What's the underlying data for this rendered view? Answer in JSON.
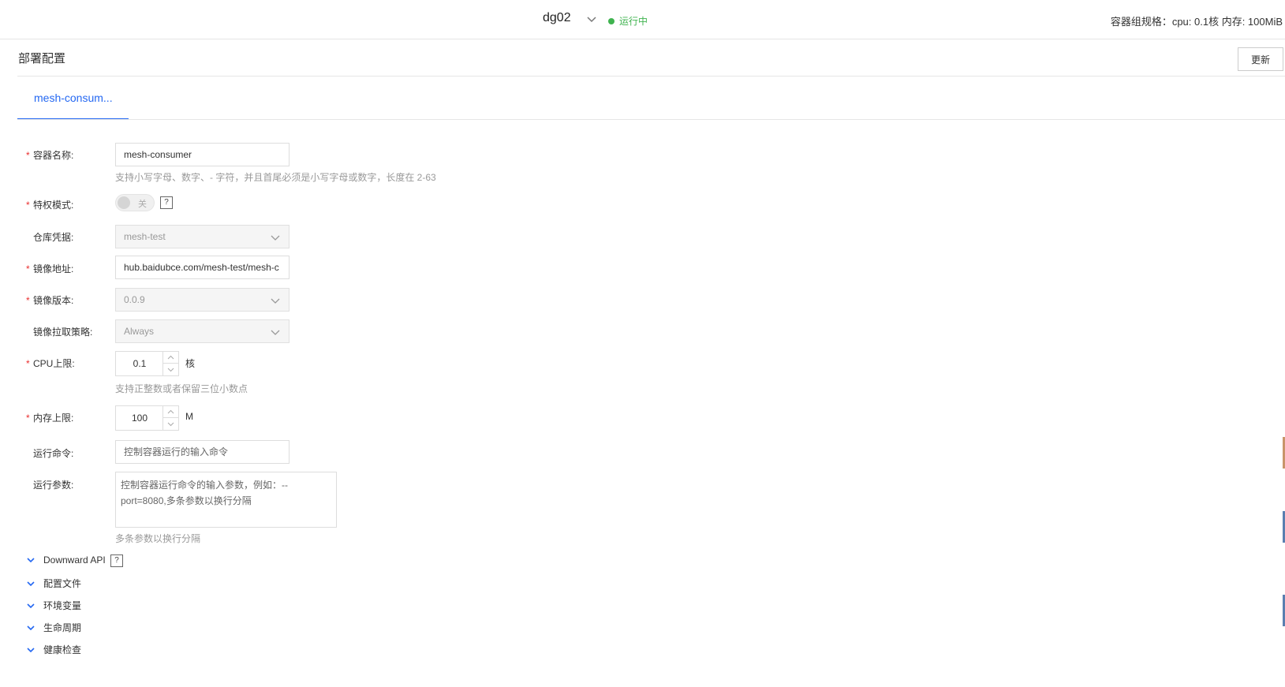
{
  "header": {
    "instance_name": "dg02",
    "status": "运行中",
    "spec_text": "容器组规格：cpu: 0.1核 内存: 100MiB"
  },
  "section": {
    "title": "部署配置",
    "update_button": "更新"
  },
  "tabs": [
    {
      "label": "mesh-consum..."
    }
  ],
  "form": {
    "container_name": {
      "label": "容器名称:",
      "value": "mesh-consumer",
      "hint": "支持小写字母、数字、- 字符，并且首尾必须是小写字母或数字，长度在 2-63"
    },
    "privileged": {
      "label": "特权模式:",
      "switch_text": "关",
      "help": "?"
    },
    "registry_credential": {
      "label": "仓库凭据:",
      "value": "mesh-test"
    },
    "image_address": {
      "label": "镜像地址:",
      "value": "hub.baidubce.com/mesh-test/mesh-c"
    },
    "image_version": {
      "label": "镜像版本:",
      "value": "0.0.9"
    },
    "pull_policy": {
      "label": "镜像拉取策略:",
      "value": "Always"
    },
    "cpu_limit": {
      "label": "CPU上限:",
      "value": "0.1",
      "unit": "核",
      "hint": "支持正整数或者保留三位小数点"
    },
    "memory_limit": {
      "label": "内存上限:",
      "value": "100",
      "unit": "M"
    },
    "run_command": {
      "label": "运行命令:",
      "placeholder": "控制容器运行的输入命令"
    },
    "run_args": {
      "label": "运行参数:",
      "placeholder": "控制容器运行命令的输入参数，例如：--port=8080,多条参数以换行分隔",
      "hint": "多条参数以换行分隔"
    }
  },
  "collapsibles": [
    {
      "label": "Downward API",
      "help": "?"
    },
    {
      "label": "配置文件"
    },
    {
      "label": "环境变量"
    },
    {
      "label": "生命周期"
    },
    {
      "label": "健康检查"
    }
  ],
  "colors": {
    "accent": "#2468f2",
    "status_green": "#3fb34f",
    "required": "#ea2e2e"
  }
}
